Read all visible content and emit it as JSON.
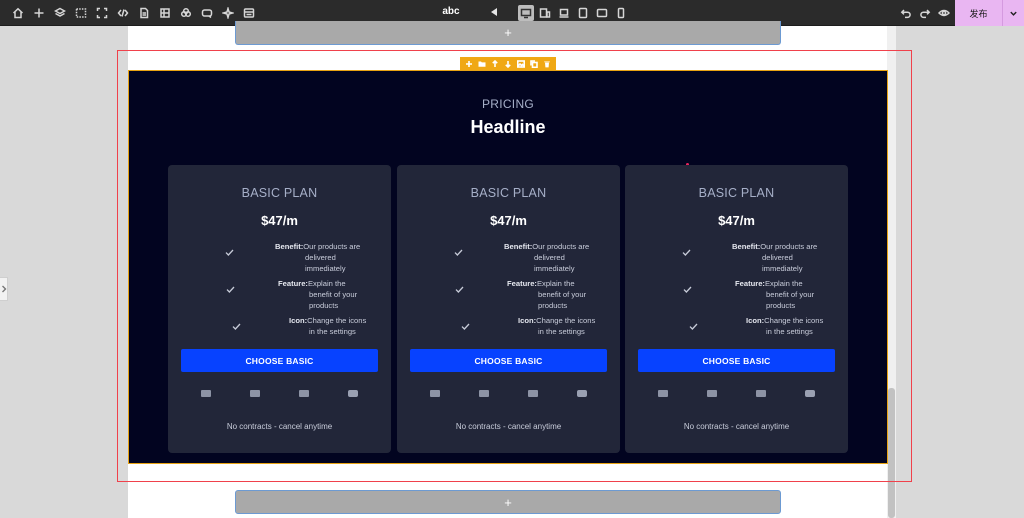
{
  "toolbar": {
    "left_icons": [
      "home-icon",
      "plus-icon",
      "layers-icon",
      "select-icon",
      "fullscreen-icon",
      "code-icon",
      "page-icon",
      "components-icon",
      "cloud-icon",
      "magic-icon",
      "form-icon"
    ],
    "title": "abc",
    "devices": [
      "desktop-icon",
      "tablet-mobile-icon",
      "laptop-icon",
      "tablet-portrait-icon",
      "tablet-landscape-icon",
      "mobile-icon"
    ],
    "active_device": "desktop-icon",
    "right_icons": [
      "undo-icon",
      "redo-icon",
      "preview-eye-icon"
    ],
    "publish_label": "发布"
  },
  "canvas": {
    "add_top_label": "+",
    "add_bottom_label": "+"
  },
  "section_toolbar": [
    "add-icon",
    "folder-icon",
    "move-up-icon",
    "move-down-icon",
    "image-icon",
    "duplicate-icon",
    "delete-icon"
  ],
  "pricing": {
    "eyebrow": "PRICING",
    "headline": "Headline",
    "cards": [
      {
        "plan": "BASIC PLAN",
        "price": "$47/m",
        "features": [
          {
            "label": "Benefit:",
            "text1": "Our products are",
            "text2": "delivered",
            "text3": "immediately"
          },
          {
            "label": "Feature:",
            "text1": "Explain the",
            "text2": "benefit of your",
            "text3": "products"
          },
          {
            "label": "Icon:",
            "text1": "Change the icons",
            "text2": "in the settings",
            "text3": ""
          }
        ],
        "cta": "CHOOSE BASIC",
        "note": "No contracts - cancel anytime"
      },
      {
        "plan": "BASIC PLAN",
        "price": "$47/m",
        "features": [
          {
            "label": "Benefit:",
            "text1": "Our products are",
            "text2": "delivered",
            "text3": "immediately"
          },
          {
            "label": "Feature:",
            "text1": "Explain the",
            "text2": "benefit of your",
            "text3": "products"
          },
          {
            "label": "Icon:",
            "text1": "Change the icons",
            "text2": "in the settings",
            "text3": ""
          }
        ],
        "cta": "CHOOSE BASIC",
        "note": "No contracts - cancel anytime"
      },
      {
        "plan": "BASIC PLAN",
        "price": "$47/m",
        "features": [
          {
            "label": "Benefit:",
            "text1": "Our products are",
            "text2": "delivered",
            "text3": "immediately"
          },
          {
            "label": "Feature:",
            "text1": "Explain the",
            "text2": "benefit of your",
            "text3": "products"
          },
          {
            "label": "Icon:",
            "text1": "Change the icons",
            "text2": "in the settings",
            "text3": ""
          }
        ],
        "cta": "CHOOSE BASIC",
        "note": "No contracts - cancel anytime"
      }
    ],
    "payment_icons": [
      "card-icon",
      "card-icon",
      "card-icon",
      "wallet-icon"
    ]
  },
  "colors": {
    "section_bg": "#020420",
    "card_bg": "#222639",
    "cta_bg": "#0742ff",
    "selection_outline": "#f0414b",
    "section_toolbar_bg": "#f0a814",
    "publish_bg": "#e9b6f2"
  }
}
